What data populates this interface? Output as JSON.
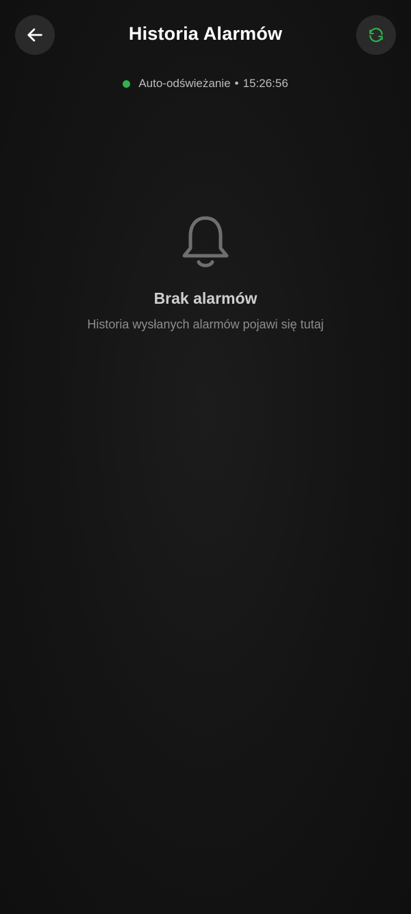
{
  "header": {
    "title": "Historia Alarmów",
    "back_icon": "arrow-left-icon",
    "refresh_icon": "refresh-icon"
  },
  "status": {
    "label": "Auto-odświeżanie",
    "separator": "•",
    "time": "15:26:56",
    "indicator_color": "#2fb34a"
  },
  "empty_state": {
    "icon": "bell-icon",
    "title": "Brak alarmów",
    "subtitle": "Historia wysłanych alarmów pojawi się tutaj"
  },
  "colors": {
    "background": "#111111",
    "button_bg": "#2a2a2a",
    "accent_green": "#2fb34a"
  }
}
